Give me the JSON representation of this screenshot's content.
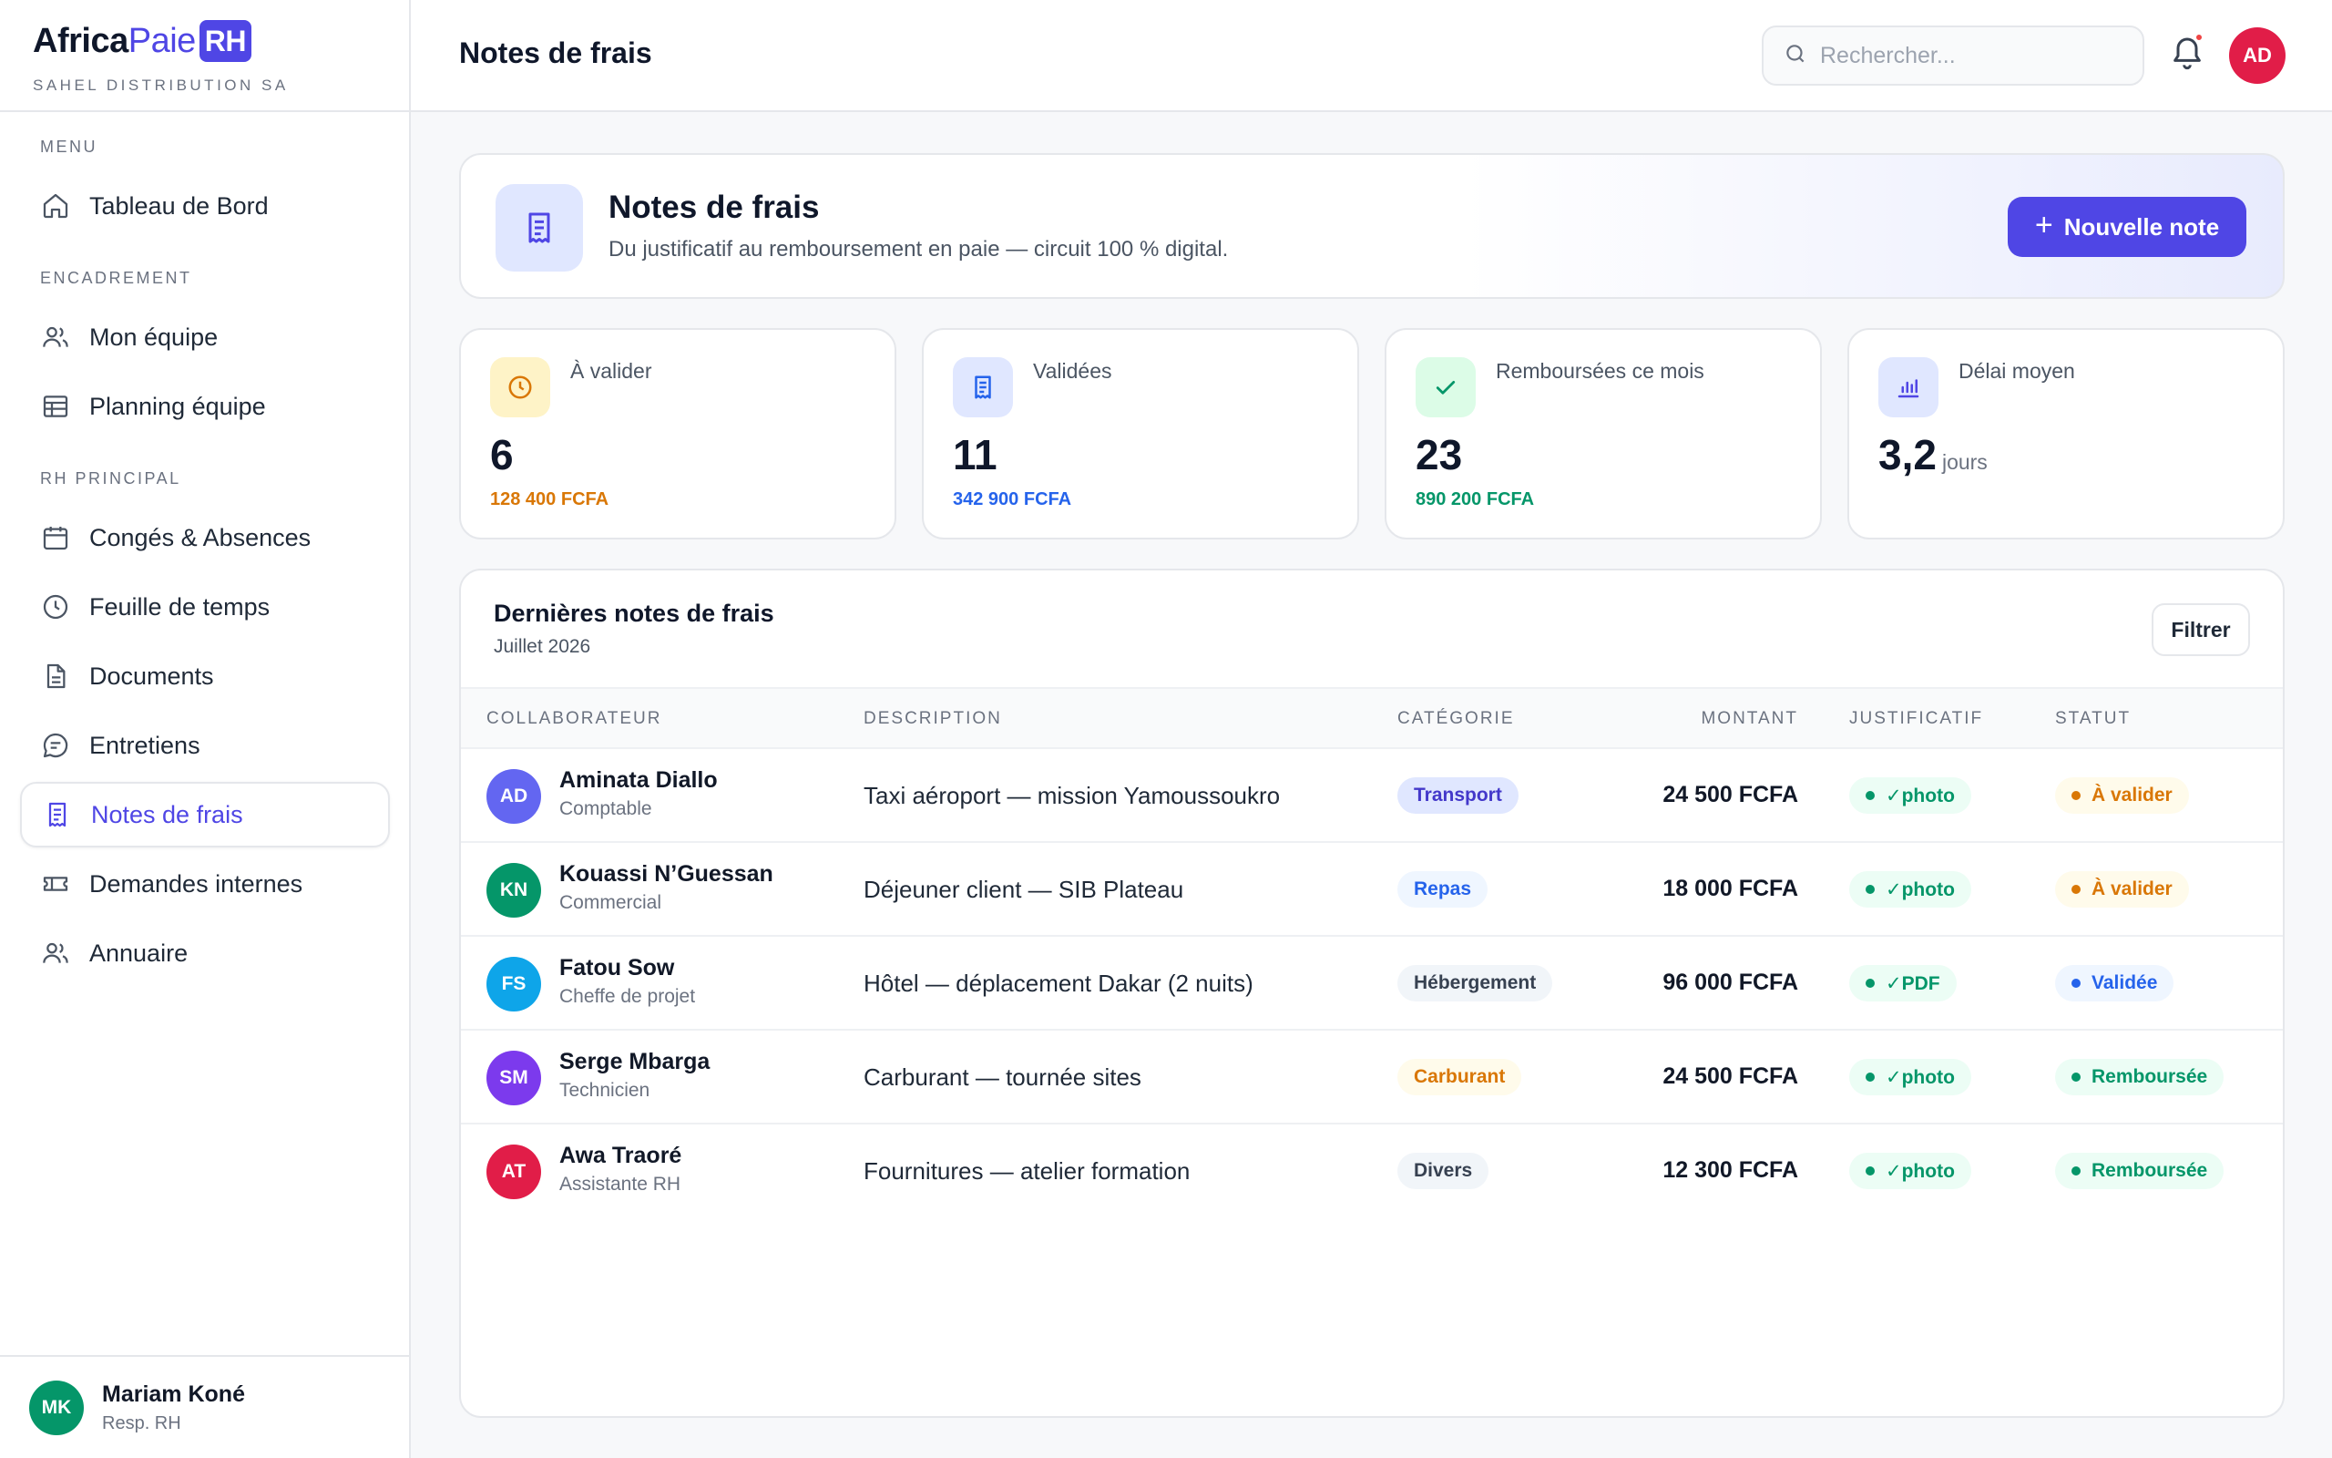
{
  "brand": {
    "logo_part1": "Africa",
    "logo_part2": "Paie",
    "logo_badge": "RH",
    "company": "SAHEL DISTRIBUTION SA"
  },
  "sidebar": {
    "sections": [
      {
        "label": "MENU"
      },
      {
        "label": "ENCADREMENT"
      },
      {
        "label": "RH PRINCIPAL"
      }
    ],
    "items": [
      {
        "label": "Tableau de Bord",
        "icon": "home-icon"
      },
      {
        "label": "Mon équipe",
        "icon": "users-icon"
      },
      {
        "label": "Planning équipe",
        "icon": "table-icon"
      },
      {
        "label": "Congés & Absences",
        "icon": "calendar-icon"
      },
      {
        "label": "Feuille de temps",
        "icon": "clock-icon"
      },
      {
        "label": "Documents",
        "icon": "document-icon"
      },
      {
        "label": "Entretiens",
        "icon": "chat-icon"
      },
      {
        "label": "Notes de frais",
        "icon": "receipt-icon",
        "active": true
      },
      {
        "label": "Demandes internes",
        "icon": "ticket-icon"
      },
      {
        "label": "Annuaire",
        "icon": "users-icon"
      }
    ],
    "user": {
      "initials": "MK",
      "name": "Mariam Koné",
      "role": "Resp. RH"
    }
  },
  "topbar": {
    "title": "Notes de frais",
    "search_placeholder": "Rechercher...",
    "avatar_initials": "AD"
  },
  "hero": {
    "title": "Notes de frais",
    "subtitle": "Du justificatif au remboursement en paie — circuit 100 % digital.",
    "button_label": "Nouvelle note",
    "button_icon": "+"
  },
  "stats": [
    {
      "label": "À valider",
      "value": "6",
      "sub": "128 400 FCFA",
      "icon": "clock-icon",
      "color": "#d97706",
      "bg": "#fef3c7"
    },
    {
      "label": "Validées",
      "value": "11",
      "sub": "342 900 FCFA",
      "icon": "receipt-icon",
      "color": "#2563eb",
      "bg": "#e0e7ff"
    },
    {
      "label": "Remboursées ce mois",
      "value": "23",
      "sub": "890 200 FCFA",
      "icon": "check-icon",
      "color": "#059669",
      "bg": "#dcfce7"
    },
    {
      "label": "Délai moyen",
      "value": "3,2",
      "unit": "jours",
      "icon": "bar-chart-icon",
      "color": "#4f46e5",
      "bg": "#e0e7ff"
    }
  ],
  "table": {
    "title": "Dernières notes de frais",
    "subtitle": "Juillet 2026",
    "filter_label": "Filtrer",
    "columns": [
      "COLLABORATEUR",
      "DESCRIPTION",
      "CATÉGORIE",
      "MONTANT",
      "JUSTIFICATIF",
      "STATUT"
    ],
    "rows": [
      {
        "initials": "AD",
        "avatar_color": "#6366f1",
        "name": "Aminata Diallo",
        "role": "Comptable",
        "description": "Taxi aéroport — mission Yamoussoukro",
        "category": "Transport",
        "amount": "24 500 FCFA",
        "proof": "✓photo",
        "status": "À valider"
      },
      {
        "initials": "KN",
        "avatar_color": "#059669",
        "name": "Kouassi N’Guessan",
        "role": "Commercial",
        "description": "Déjeuner client — SIB Plateau",
        "category": "Repas",
        "amount": "18 000 FCFA",
        "proof": "✓photo",
        "status": "À valider"
      },
      {
        "initials": "FS",
        "avatar_color": "#0ea5e9",
        "name": "Fatou Sow",
        "role": "Cheffe de projet",
        "description": "Hôtel — déplacement Dakar (2 nuits)",
        "category": "Hébergement",
        "amount": "96 000 FCFA",
        "proof": "✓PDF",
        "status": "Validée"
      },
      {
        "initials": "SM",
        "avatar_color": "#7c3aed",
        "name": "Serge Mbarga",
        "role": "Technicien",
        "description": "Carburant — tournée sites",
        "category": "Carburant",
        "amount": "24 500 FCFA",
        "proof": "✓photo",
        "status": "Remboursée"
      },
      {
        "initials": "AT",
        "avatar_color": "#e11d48",
        "name": "Awa Traoré",
        "role": "Assistante RH",
        "description": "Fournitures — atelier formation",
        "category": "Divers",
        "amount": "12 300 FCFA",
        "proof": "✓photo",
        "status": "Remboursée"
      }
    ]
  },
  "colors": {
    "accent": "#4f46e5",
    "pending": "#d97706",
    "validated": "#2563eb",
    "reimbursed": "#059669"
  }
}
